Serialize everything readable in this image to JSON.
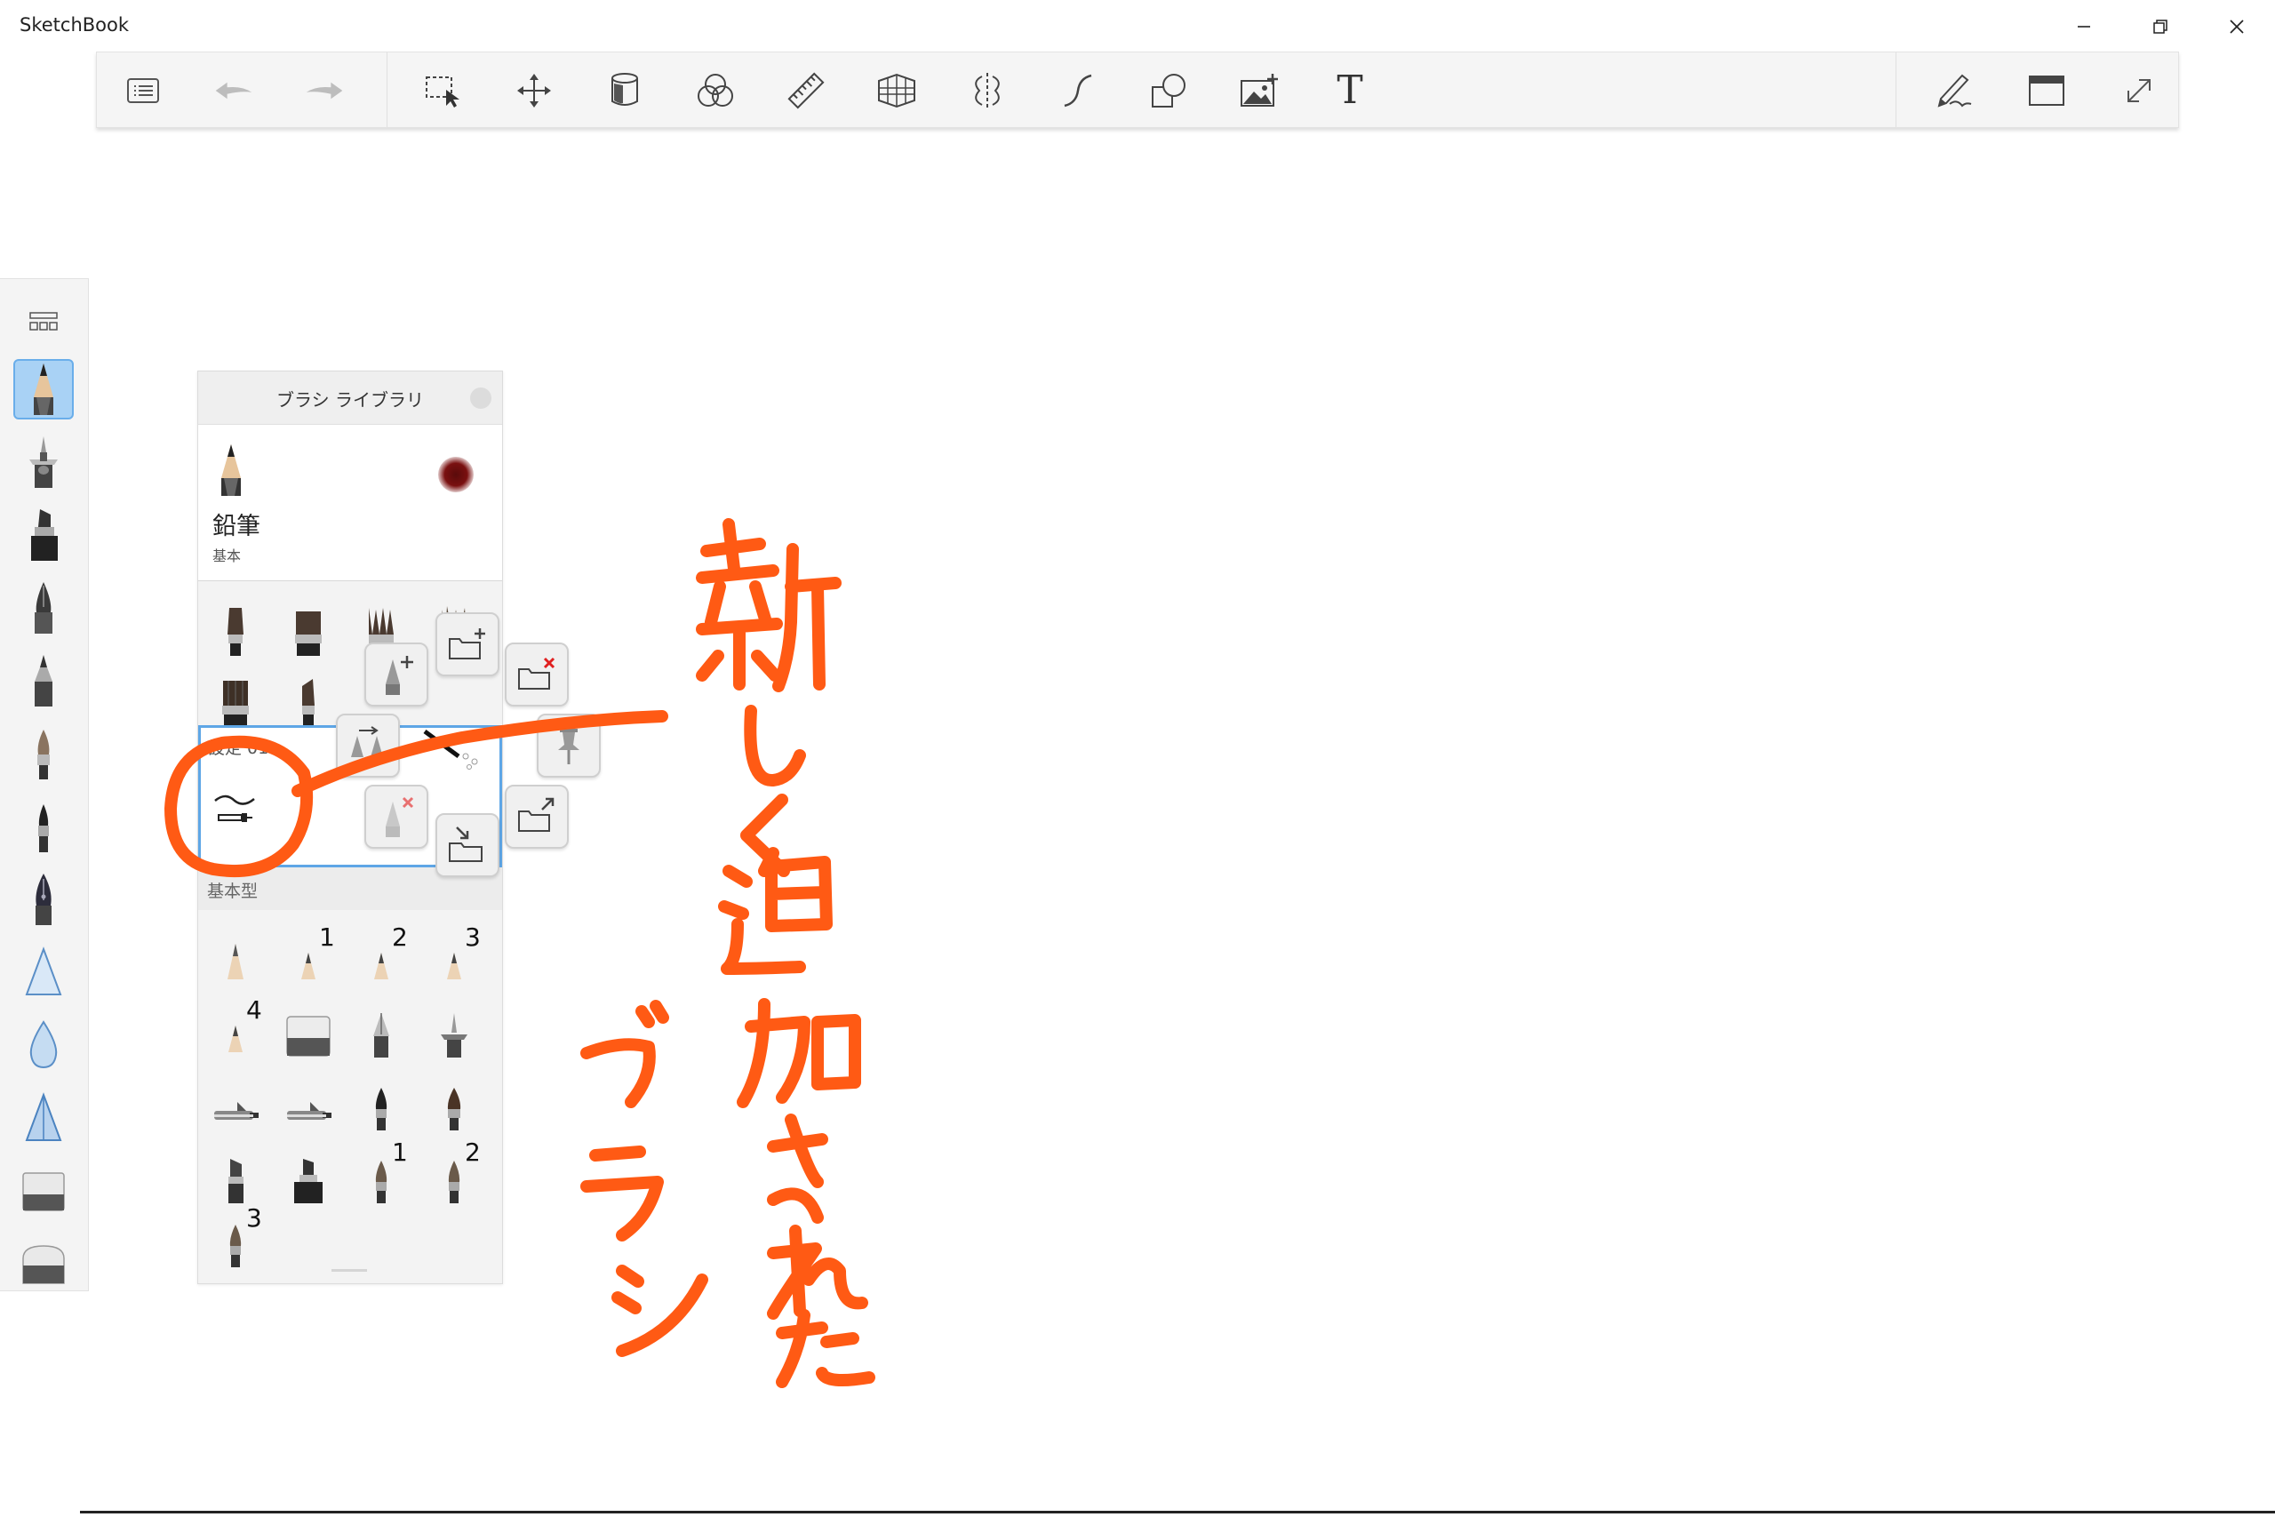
{
  "app": {
    "title": "SketchBook"
  },
  "window_controls": {
    "minimize": "minimize-icon",
    "restore": "restore-icon",
    "close": "close-icon"
  },
  "toolbar": {
    "items": [
      {
        "name": "menu-list-icon"
      },
      {
        "name": "undo-icon"
      },
      {
        "name": "redo-icon"
      },
      {
        "name": "selection-icon"
      },
      {
        "name": "transform-icon"
      },
      {
        "name": "fill-bucket-icon"
      },
      {
        "name": "color-editor-icon"
      },
      {
        "name": "ruler-icon"
      },
      {
        "name": "perspective-icon"
      },
      {
        "name": "symmetry-icon"
      },
      {
        "name": "stroke-tool-icon"
      },
      {
        "name": "shapes-icon"
      },
      {
        "name": "add-image-icon"
      },
      {
        "name": "text-icon"
      },
      {
        "name": "brush-properties-icon"
      },
      {
        "name": "ui-layout-icon"
      },
      {
        "name": "fullscreen-icon"
      }
    ],
    "text_tool_glyph": "T"
  },
  "left_palette": {
    "toggle_icon": "grid-icon",
    "active_index": 0,
    "tools": [
      "pencil",
      "airbrush",
      "marker",
      "ink-pen",
      "ballpoint",
      "brush",
      "fine-brush",
      "nib-pen",
      "smudge-cone",
      "blur-drop",
      "sharpen-cone",
      "eraser-block",
      "eraser-round"
    ]
  },
  "brush_library": {
    "title": "ブラシ ライブラリ",
    "current_brush": {
      "name": "鉛筆",
      "category": "基本",
      "color": "#6b0f0f"
    },
    "set_section": {
      "label": "設定 01"
    },
    "sub_section": {
      "label": "基本型"
    },
    "numbers": {
      "n1": "1",
      "n2": "2",
      "n3": "3",
      "n4": "4",
      "n5": "1",
      "n6": "2",
      "n7": "3"
    }
  },
  "annotation": {
    "text": "新しく追加されたブラシ",
    "color": "#ff5a14"
  }
}
